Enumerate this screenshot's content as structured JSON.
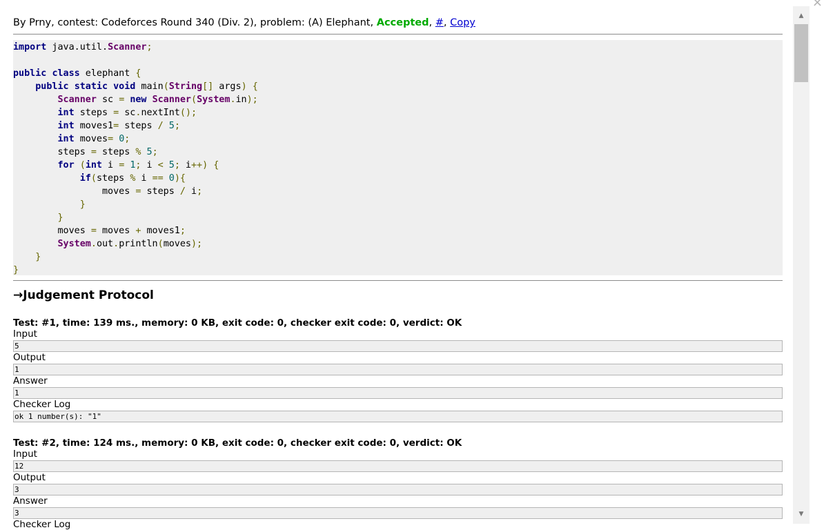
{
  "header": {
    "prefix": "By Prny, contest: Codeforces Round 340 (Div. 2), problem: (A) Elephant, ",
    "verdict": "Accepted",
    "comma1": ", ",
    "hash_link": "#",
    "comma2": ", ",
    "copy_link": "Copy"
  },
  "code_lines": [
    [
      [
        "kw",
        "import"
      ],
      [
        "pl",
        " java.util."
      ],
      [
        "ty",
        "Scanner"
      ],
      [
        "pu",
        ";"
      ]
    ],
    [],
    [
      [
        "kw",
        "public"
      ],
      [
        "pl",
        " "
      ],
      [
        "kw",
        "class"
      ],
      [
        "pl",
        " elephant "
      ],
      [
        "pu",
        "{"
      ]
    ],
    [
      [
        "pl",
        "    "
      ],
      [
        "kw",
        "public"
      ],
      [
        "pl",
        " "
      ],
      [
        "kw",
        "static"
      ],
      [
        "pl",
        " "
      ],
      [
        "kw",
        "void"
      ],
      [
        "pl",
        " main"
      ],
      [
        "pu",
        "("
      ],
      [
        "ty",
        "String"
      ],
      [
        "pu",
        "[]"
      ],
      [
        "pl",
        " args"
      ],
      [
        "pu",
        ")"
      ],
      [
        "pl",
        " "
      ],
      [
        "pu",
        "{"
      ]
    ],
    [
      [
        "pl",
        "        "
      ],
      [
        "ty",
        "Scanner"
      ],
      [
        "pl",
        " sc "
      ],
      [
        "pu",
        "="
      ],
      [
        "pl",
        " "
      ],
      [
        "kw",
        "new"
      ],
      [
        "pl",
        " "
      ],
      [
        "ty",
        "Scanner"
      ],
      [
        "pu",
        "("
      ],
      [
        "ty",
        "System"
      ],
      [
        "pu",
        "."
      ],
      [
        "pl",
        "in"
      ],
      [
        "pu",
        ");"
      ]
    ],
    [
      [
        "pl",
        "        "
      ],
      [
        "kw",
        "int"
      ],
      [
        "pl",
        " steps "
      ],
      [
        "pu",
        "="
      ],
      [
        "pl",
        " sc"
      ],
      [
        "pu",
        "."
      ],
      [
        "pl",
        "nextInt"
      ],
      [
        "pu",
        "();"
      ]
    ],
    [
      [
        "pl",
        "        "
      ],
      [
        "kw",
        "int"
      ],
      [
        "pl",
        " moves1"
      ],
      [
        "pu",
        "="
      ],
      [
        "pl",
        " steps "
      ],
      [
        "pu",
        "/"
      ],
      [
        "pl",
        " "
      ],
      [
        "nu",
        "5"
      ],
      [
        "pu",
        ";"
      ]
    ],
    [
      [
        "pl",
        "        "
      ],
      [
        "kw",
        "int"
      ],
      [
        "pl",
        " moves"
      ],
      [
        "pu",
        "="
      ],
      [
        "pl",
        " "
      ],
      [
        "nu",
        "0"
      ],
      [
        "pu",
        ";"
      ]
    ],
    [
      [
        "pl",
        "        steps "
      ],
      [
        "pu",
        "="
      ],
      [
        "pl",
        " steps "
      ],
      [
        "pu",
        "%"
      ],
      [
        "pl",
        " "
      ],
      [
        "nu",
        "5"
      ],
      [
        "pu",
        ";"
      ]
    ],
    [
      [
        "pl",
        "        "
      ],
      [
        "kw",
        "for"
      ],
      [
        "pl",
        " "
      ],
      [
        "pu",
        "("
      ],
      [
        "kw",
        "int"
      ],
      [
        "pl",
        " i "
      ],
      [
        "pu",
        "="
      ],
      [
        "pl",
        " "
      ],
      [
        "nu",
        "1"
      ],
      [
        "pu",
        ";"
      ],
      [
        "pl",
        " i "
      ],
      [
        "pu",
        "<"
      ],
      [
        "pl",
        " "
      ],
      [
        "nu",
        "5"
      ],
      [
        "pu",
        ";"
      ],
      [
        "pl",
        " i"
      ],
      [
        "pu",
        "++)"
      ],
      [
        "pl",
        " "
      ],
      [
        "pu",
        "{"
      ]
    ],
    [
      [
        "pl",
        "            "
      ],
      [
        "kw",
        "if"
      ],
      [
        "pu",
        "("
      ],
      [
        "pl",
        "steps "
      ],
      [
        "pu",
        "%"
      ],
      [
        "pl",
        " i "
      ],
      [
        "pu",
        "=="
      ],
      [
        "pl",
        " "
      ],
      [
        "nu",
        "0"
      ],
      [
        "pu",
        "){"
      ]
    ],
    [
      [
        "pl",
        "                moves "
      ],
      [
        "pu",
        "="
      ],
      [
        "pl",
        " steps "
      ],
      [
        "pu",
        "/"
      ],
      [
        "pl",
        " i"
      ],
      [
        "pu",
        ";"
      ]
    ],
    [
      [
        "pl",
        "            "
      ],
      [
        "pu",
        "}"
      ]
    ],
    [
      [
        "pl",
        "        "
      ],
      [
        "pu",
        "}"
      ]
    ],
    [
      [
        "pl",
        "        moves "
      ],
      [
        "pu",
        "="
      ],
      [
        "pl",
        " moves "
      ],
      [
        "pu",
        "+"
      ],
      [
        "pl",
        " moves1"
      ],
      [
        "pu",
        ";"
      ]
    ],
    [
      [
        "pl",
        "        "
      ],
      [
        "ty",
        "System"
      ],
      [
        "pu",
        "."
      ],
      [
        "pl",
        "out"
      ],
      [
        "pu",
        "."
      ],
      [
        "pl",
        "println"
      ],
      [
        "pu",
        "("
      ],
      [
        "pl",
        "moves"
      ],
      [
        "pu",
        ");"
      ]
    ],
    [
      [
        "pl",
        "    "
      ],
      [
        "pu",
        "}"
      ]
    ],
    [
      [
        "pu",
        "}"
      ]
    ]
  ],
  "protocol_title": "→Judgement Protocol",
  "tests": [
    {
      "head": "Test: #1, time: 139 ms., memory: 0 KB, exit code: 0, checker exit code: 0, verdict: OK",
      "input_label": "Input",
      "input": "5",
      "output_label": "Output",
      "output": "1",
      "answer_label": "Answer",
      "answer": "1",
      "log_label": "Checker Log",
      "log": "ok 1 number(s): \"1\""
    },
    {
      "head": "Test: #2, time: 124 ms., memory: 0 KB, exit code: 0, checker exit code: 0, verdict: OK",
      "input_label": "Input",
      "input": "12",
      "output_label": "Output",
      "output": "3",
      "answer_label": "Answer",
      "answer": "3",
      "log_label": "Checker Log",
      "log": ""
    }
  ],
  "icons": {
    "close": "×",
    "scroll_up": "▲",
    "scroll_down": "▼"
  }
}
